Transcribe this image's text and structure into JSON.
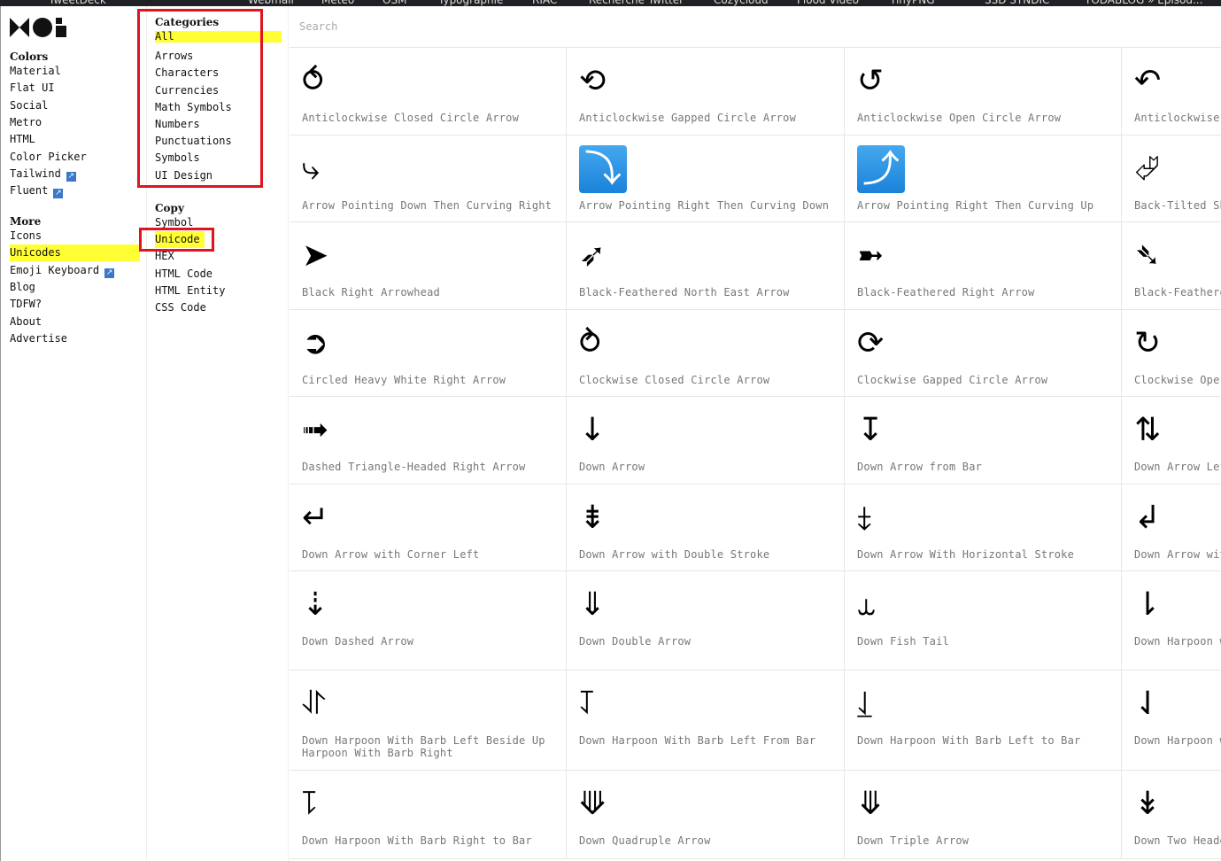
{
  "bookmarks": [
    "TweetDeck",
    "Webmail",
    "Meteo",
    "OSM",
    "Typographie",
    "RIAC",
    "Recherche Twitter",
    "Cozycloud",
    "Flood Video",
    "TinyPNG",
    "SSD SYNDIC",
    "TODABLOG » Episod..."
  ],
  "nav": {
    "colors_heading": "Colors",
    "colors": [
      {
        "label": "Material"
      },
      {
        "label": "Flat UI"
      },
      {
        "label": "Social"
      },
      {
        "label": "Metro"
      },
      {
        "label": "HTML"
      },
      {
        "label": "Color Picker"
      },
      {
        "label": "Tailwind",
        "external": true
      },
      {
        "label": "Fluent",
        "external": true
      }
    ],
    "more_heading": "More",
    "more": [
      {
        "label": "Icons"
      },
      {
        "label": "Unicodes",
        "selected": true
      },
      {
        "label": "Emoji Keyboard",
        "external": true
      },
      {
        "label": "Blog"
      },
      {
        "label": "TDFW?"
      },
      {
        "label": "About"
      },
      {
        "label": "Advertise"
      }
    ],
    "ext_glyph": "↗"
  },
  "categories": {
    "heading": "Categories",
    "items": [
      {
        "label": "All",
        "selected": true
      },
      {
        "label": "Arrows"
      },
      {
        "label": "Characters"
      },
      {
        "label": "Currencies"
      },
      {
        "label": "Math Symbols"
      },
      {
        "label": "Numbers"
      },
      {
        "label": "Punctuations"
      },
      {
        "label": "Symbols"
      },
      {
        "label": "UI Design"
      }
    ]
  },
  "copy": {
    "heading": "Copy",
    "items": [
      {
        "label": "Symbol"
      },
      {
        "label": "Unicode",
        "selected": true
      },
      {
        "label": "HEX"
      },
      {
        "label": "HTML Code"
      },
      {
        "label": "HTML Entity"
      },
      {
        "label": "CSS Code"
      }
    ]
  },
  "search": {
    "placeholder": "Search"
  },
  "colors": {
    "highlight": "#ffff33",
    "annotation_red": "#e0141e",
    "emoji_blue": "#2b93e6"
  },
  "symbols": [
    {
      "glyph": "⥀",
      "name": "Anticlockwise Closed Circle Arrow"
    },
    {
      "glyph": "⟲",
      "name": "Anticlockwise Gapped Circle Arrow"
    },
    {
      "glyph": "↺",
      "name": "Anticlockwise Open Circle Arrow"
    },
    {
      "glyph": "↶",
      "name": "Anticlockwise"
    },
    {
      "glyph": "⤷",
      "name": "Arrow Pointing Down Then Curving Right"
    },
    {
      "glyph": "⤵",
      "name": "Arrow Pointing Right Then Curving Down",
      "emoji": true
    },
    {
      "glyph": "⤴",
      "name": "Arrow Pointing Right Then Curving Up",
      "emoji": true
    },
    {
      "glyph": "⮰",
      "name": "Back-Tilted Sh"
    },
    {
      "glyph": "➤",
      "name": "Black Right Arrowhead"
    },
    {
      "glyph": "➶",
      "name": "Black-Feathered North East Arrow"
    },
    {
      "glyph": "➼",
      "name": "Black-Feathered Right Arrow"
    },
    {
      "glyph": "➴",
      "name": "Black-Feathere"
    },
    {
      "glyph": "➲",
      "name": "Circled Heavy White Right Arrow"
    },
    {
      "glyph": "⥁",
      "name": "Clockwise Closed Circle Arrow"
    },
    {
      "glyph": "⟳",
      "name": "Clockwise Gapped Circle Arrow"
    },
    {
      "glyph": "↻",
      "name": "Clockwise Oper"
    },
    {
      "glyph": "➟",
      "name": "Dashed Triangle-Headed Right Arrow"
    },
    {
      "glyph": "↓",
      "name": "Down Arrow"
    },
    {
      "glyph": "↧",
      "name": "Down Arrow from Bar"
    },
    {
      "glyph": "⇅",
      "name": "Down Arrow Lef"
    },
    {
      "glyph": "↵",
      "name": "Down Arrow with Corner Left"
    },
    {
      "glyph": "⇟",
      "name": "Down Arrow with Double Stroke"
    },
    {
      "glyph": "⤈",
      "name": "Down Arrow With Horizontal Stroke"
    },
    {
      "glyph": "↲",
      "name": "Down Arrow wit"
    },
    {
      "glyph": "⇣",
      "name": "Down Dashed Arrow"
    },
    {
      "glyph": "⇓",
      "name": "Down Double Arrow"
    },
    {
      "glyph": "⥿",
      "name": "Down Fish Tail"
    },
    {
      "glyph": "⇂",
      "name": "Down Harpoon w"
    },
    {
      "glyph": "⥯",
      "name": "Down Harpoon With Barb Left Beside Up Harpoon With Barb Right"
    },
    {
      "glyph": "⥡",
      "name": "Down Harpoon With Barb Left From Bar"
    },
    {
      "glyph": "⥙",
      "name": "Down Harpoon With Barb Left to Bar"
    },
    {
      "glyph": "⇃",
      "name": "Down Harpoon w"
    },
    {
      "glyph": "⥝",
      "name": "Down Harpoon With Barb Right to Bar"
    },
    {
      "glyph": "⟱",
      "name": "Down Quadruple Arrow"
    },
    {
      "glyph": "⤋",
      "name": "Down Triple Arrow"
    },
    {
      "glyph": "↡",
      "name": "Down Two Heade"
    }
  ]
}
